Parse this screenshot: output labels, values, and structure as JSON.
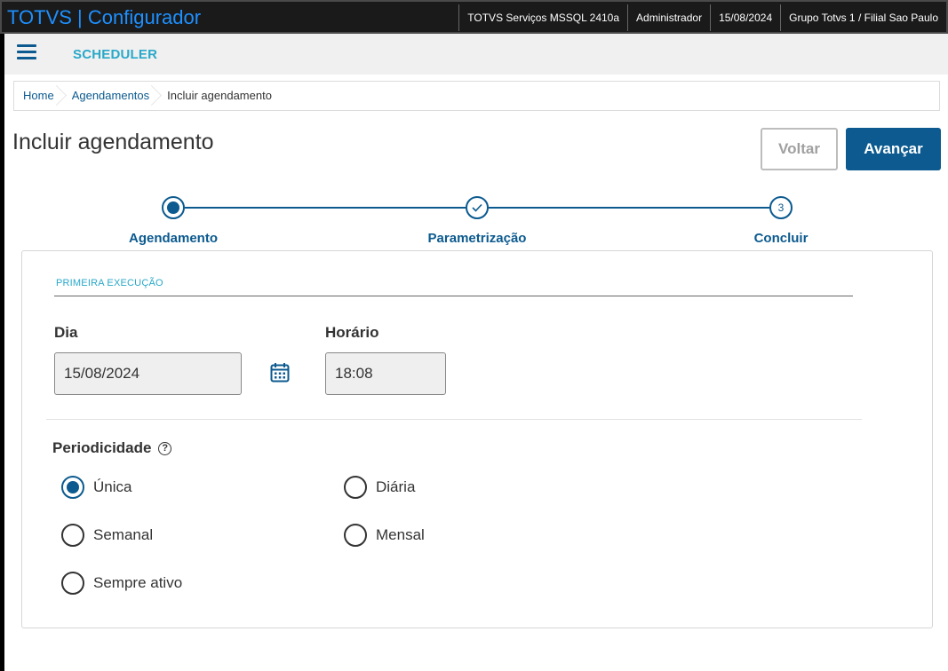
{
  "topbar": {
    "title": "TOTVS | Configurador",
    "environment": "TOTVS Serviços MSSQL 2410a",
    "user": "Administrador",
    "date": "15/08/2024",
    "branch": "Grupo Totvs 1 / Filial Sao Paulo"
  },
  "header": {
    "module": "SCHEDULER"
  },
  "breadcrumb": [
    "Home",
    "Agendamentos",
    "Incluir agendamento"
  ],
  "page": {
    "title": "Incluir agendamento",
    "back_label": "Voltar",
    "next_label": "Avançar"
  },
  "stepper": {
    "steps": [
      {
        "label": "Agendamento",
        "state": "active"
      },
      {
        "label": "Parametrização",
        "state": "done"
      },
      {
        "label": "Concluir",
        "state": "pending",
        "number": "3"
      }
    ]
  },
  "form": {
    "section": "PRIMEIRA EXECUÇÃO",
    "day_label": "Dia",
    "day_value": "15/08/2024",
    "time_label": "Horário",
    "time_value": "18:08",
    "periodicity_label": "Periodicidade",
    "help_glyph": "?",
    "options": [
      {
        "label": "Única",
        "checked": true
      },
      {
        "label": "Diária",
        "checked": false
      },
      {
        "label": "Semanal",
        "checked": false
      },
      {
        "label": "Mensal",
        "checked": false
      },
      {
        "label": "Sempre ativo",
        "checked": false
      }
    ]
  },
  "colors": {
    "primary": "#0c5a8f",
    "accent": "#29a8c9",
    "title_blue": "#1e90ff"
  }
}
